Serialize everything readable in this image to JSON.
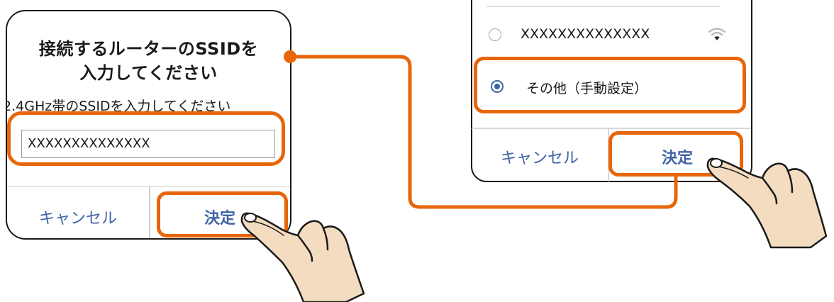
{
  "left_dialog": {
    "title": "接続するルーターのSSIDを\n入力してください",
    "message": "2.4GHz帯のSSIDを入力してください",
    "ssid_input_value": "XXXXXXXXXXXXXX",
    "cancel_label": "キャンセル",
    "confirm_label": "決定"
  },
  "right_dialog": {
    "network_option_label": "XXXXXXXXXXXXXX",
    "network_signal_icon": "wifi-icon",
    "other_option_label": "その他（手動設定）",
    "selected_option": "other",
    "cancel_label": "キャンセル",
    "confirm_label": "決定"
  },
  "colors": {
    "highlight": "#e8660a",
    "button_text": "#3f64a7",
    "radio_selected": "#3f64a7",
    "hand_fill": "#f3dcc0",
    "hand_stroke": "#1a1a1a"
  }
}
